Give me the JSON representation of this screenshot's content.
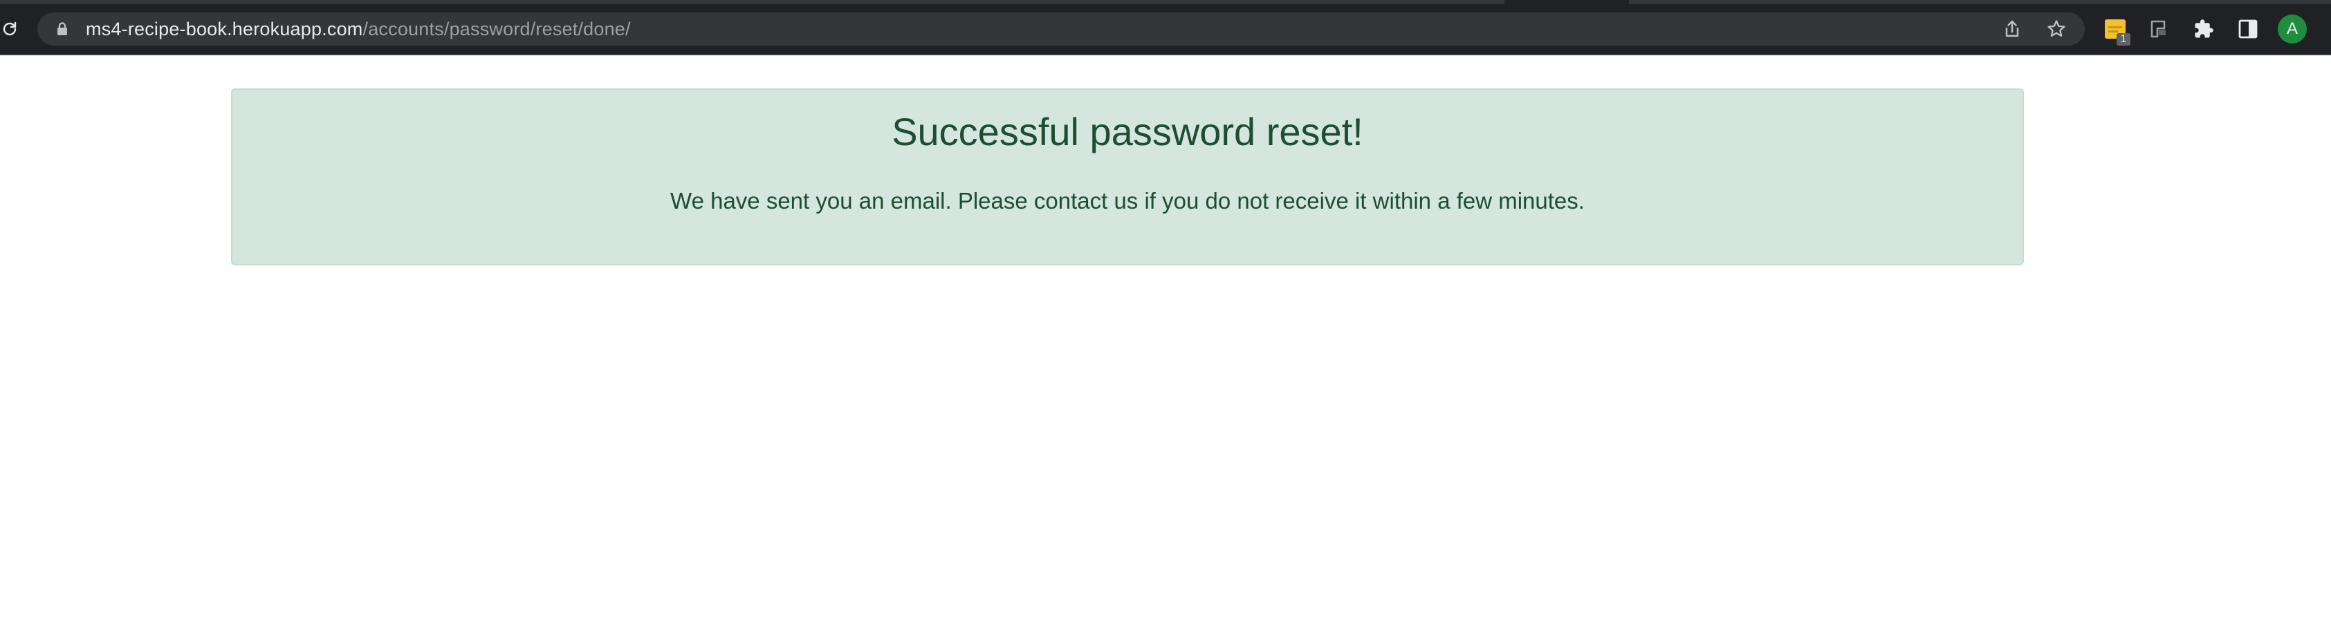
{
  "browser": {
    "url_host": "ms4-recipe-book.herokuapp.com",
    "url_path": "/accounts/password/reset/done/",
    "icons": {
      "reload": "reload-icon",
      "lock": "lock-icon",
      "share": "share-icon",
      "bookmark": "star-icon",
      "extension_1": "note-extension-icon",
      "extension_2": "flag-extension-icon",
      "extensions_menu": "puzzle-icon",
      "side_panel": "side-panel-icon"
    },
    "extension_badge": "1",
    "profile_initial": "A"
  },
  "alert": {
    "heading": "Successful password reset!",
    "message": "We have sent you an email. Please contact us if you do not receive it within a few minutes.",
    "colors": {
      "background": "#d4e6dd",
      "border": "#c3dbcf",
      "text": "#1d4d32"
    }
  }
}
